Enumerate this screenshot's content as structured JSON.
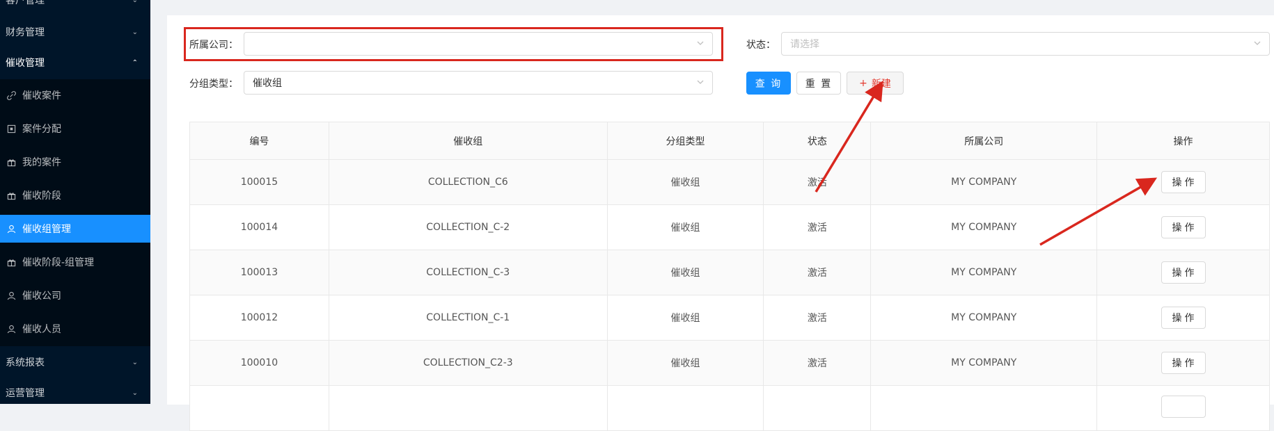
{
  "sidebar": {
    "top_items": [
      {
        "label": "客户管理"
      },
      {
        "label": "财务管理"
      },
      {
        "label": "催收管理"
      }
    ],
    "sub_items": [
      {
        "label": "催收案件",
        "icon": "link-icon"
      },
      {
        "label": "案件分配",
        "icon": "assign-icon"
      },
      {
        "label": "我的案件",
        "icon": "gift-icon"
      },
      {
        "label": "催收阶段",
        "icon": "gift-icon"
      },
      {
        "label": "催收组管理",
        "icon": "user-icon",
        "active": true
      },
      {
        "label": "催收阶段-组管理",
        "icon": "gift-icon"
      },
      {
        "label": "催收公司",
        "icon": "user-icon"
      },
      {
        "label": "催收人员",
        "icon": "user-icon"
      }
    ],
    "bottom_items": [
      {
        "label": "系统报表"
      },
      {
        "label": "运营管理"
      }
    ]
  },
  "filters": {
    "company_label": "所属公司：",
    "company_value": "",
    "status_label": "状态：",
    "status_placeholder": "请选择",
    "group_type_label": "分组类型：",
    "group_type_value": "催收组"
  },
  "buttons": {
    "query": "查 询",
    "reset": "重 置",
    "new_icon": "+",
    "new": "新建"
  },
  "table": {
    "headers": [
      "编号",
      "催收组",
      "分组类型",
      "状态",
      "所属公司",
      "操作"
    ],
    "rows": [
      {
        "id": "100015",
        "group": "COLLECTION_C6",
        "type": "催收组",
        "status": "激活",
        "company": "MY COMPANY",
        "op": "操作"
      },
      {
        "id": "100014",
        "group": "COLLECTION_C-2",
        "type": "催收组",
        "status": "激活",
        "company": "MY COMPANY",
        "op": "操作"
      },
      {
        "id": "100013",
        "group": "COLLECTION_C-3",
        "type": "催收组",
        "status": "激活",
        "company": "MY COMPANY",
        "op": "操作"
      },
      {
        "id": "100012",
        "group": "COLLECTION_C-1",
        "type": "催收组",
        "status": "激活",
        "company": "MY COMPANY",
        "op": "操作"
      },
      {
        "id": "100010",
        "group": "COLLECTION_C2-3",
        "type": "催收组",
        "status": "激活",
        "company": "MY COMPANY",
        "op": "操作"
      }
    ]
  },
  "colors": {
    "sidebar_bg": "#001529",
    "submenu_bg": "#000c17",
    "primary": "#1890ff",
    "annotation_red": "#d9271e"
  }
}
